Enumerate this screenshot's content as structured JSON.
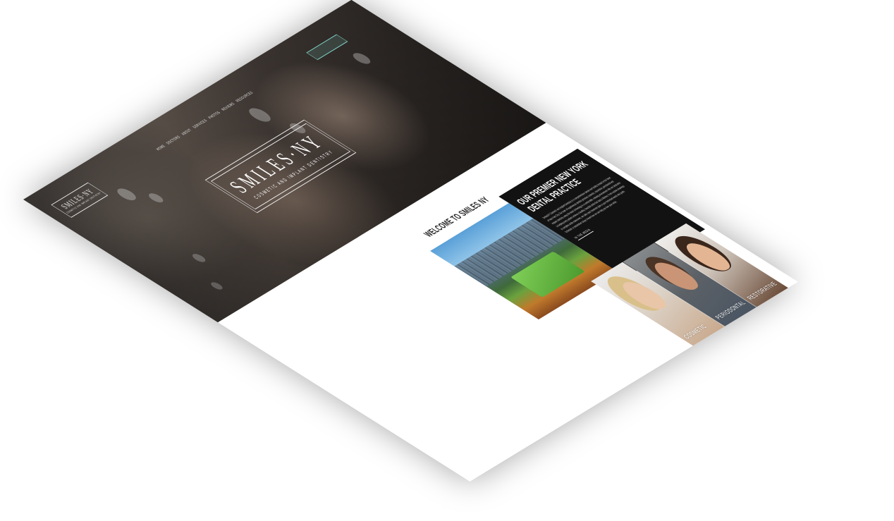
{
  "header": {
    "logo_main": "SMILES·NY",
    "logo_sub": "COSMETIC AND IMPLANT DENTISTRY",
    "nav": [
      "HOME",
      "DOCTORS",
      "ABOUT",
      "SERVICES",
      "PHOTOS",
      "REVIEWS",
      "RESOURCES"
    ],
    "cta_label": ""
  },
  "hero": {
    "title": "SMILES·NY",
    "subtitle": "COSMETIC AND IMPLANT DENTISTRY"
  },
  "welcome": {
    "heading": "WELCOME TO SMILES NY"
  },
  "practice": {
    "title": "OUR PREMIER NEW YORK DENTAL PRACTICE",
    "body": "SmilesNY Cosmetic and Implant Dentistry is a comprehensive dental care facility located in the heart of New York City. Our team of experienced dentists provides cosmetic, restorative, periodontal and implant dentistry using the latest technology in a comfortable, relaxing environment. We are dedicated to helping every patient achieve a healthy, beautiful smile that lasts a lifetime. From routine cleanings to complete smile makeovers, we tailor each treatment plan to your individual needs and goals. Schedule a consultation today to learn how we can help you love your smile.",
    "link_label": "IN THE MEDIA"
  },
  "services": [
    {
      "label": "COSMETIC"
    },
    {
      "label": "PERIODONTAL"
    },
    {
      "label": "RESTORATIVE"
    }
  ],
  "colors": {
    "practice_bg": "#121212",
    "cta_accent": "#7fd6c8",
    "page_bg": "#ffffff"
  }
}
